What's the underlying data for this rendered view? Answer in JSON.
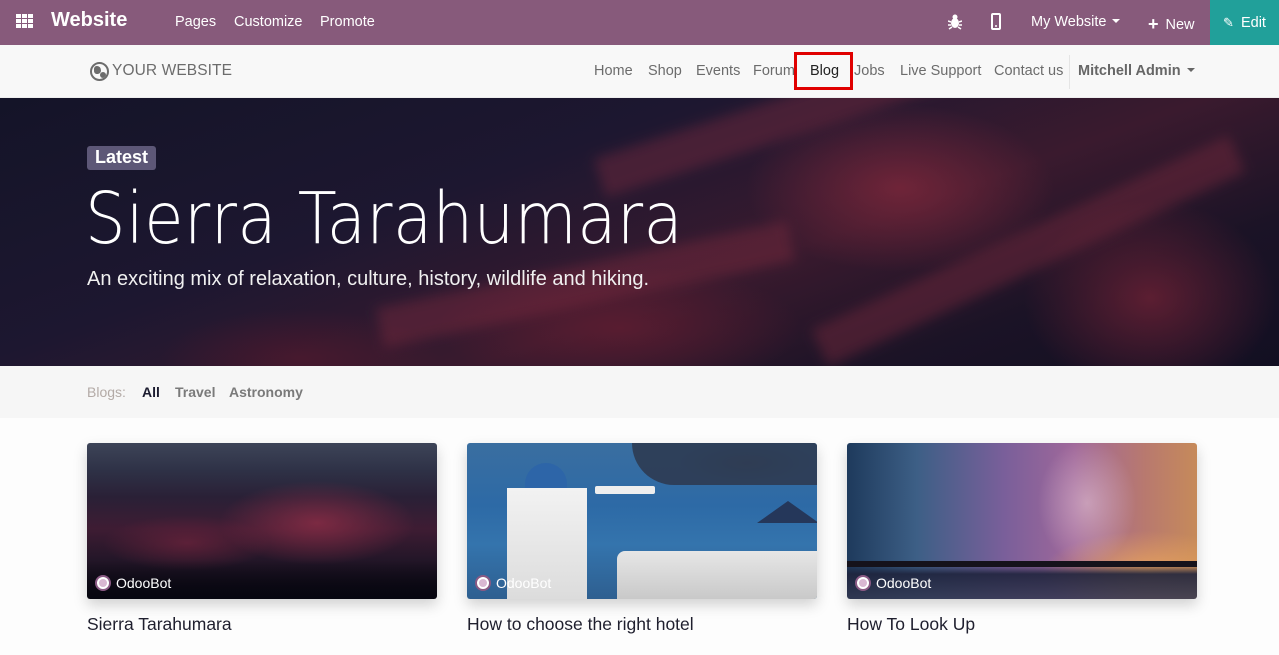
{
  "topbar": {
    "app_name": "Website",
    "menus": [
      "Pages",
      "Customize",
      "Promote"
    ],
    "website_selector": "My Website",
    "new_label": "New",
    "edit_label": "Edit",
    "colors": {
      "bar": "#875a7b",
      "edit": "#21a09a"
    }
  },
  "site_header": {
    "logo_text": "YOUR WEBSITE",
    "nav": [
      "Home",
      "Shop",
      "Events",
      "Forum",
      "Blog",
      "Jobs",
      "Live Support",
      "Contact us"
    ],
    "active_nav": "Blog",
    "user": "Mitchell Admin"
  },
  "hero": {
    "badge": "Latest",
    "title": "Sierra Tarahumara",
    "subtitle": "An exciting mix of relaxation, culture, history, wildlife and hiking."
  },
  "filters": {
    "label": "Blogs:",
    "items": [
      "All",
      "Travel",
      "Astronomy"
    ],
    "active": "All"
  },
  "posts": [
    {
      "author": "OdooBot",
      "title": "Sierra Tarahumara"
    },
    {
      "author": "OdooBot",
      "title": "How to choose the right hotel"
    },
    {
      "author": "OdooBot",
      "title": "How To Look Up"
    }
  ]
}
